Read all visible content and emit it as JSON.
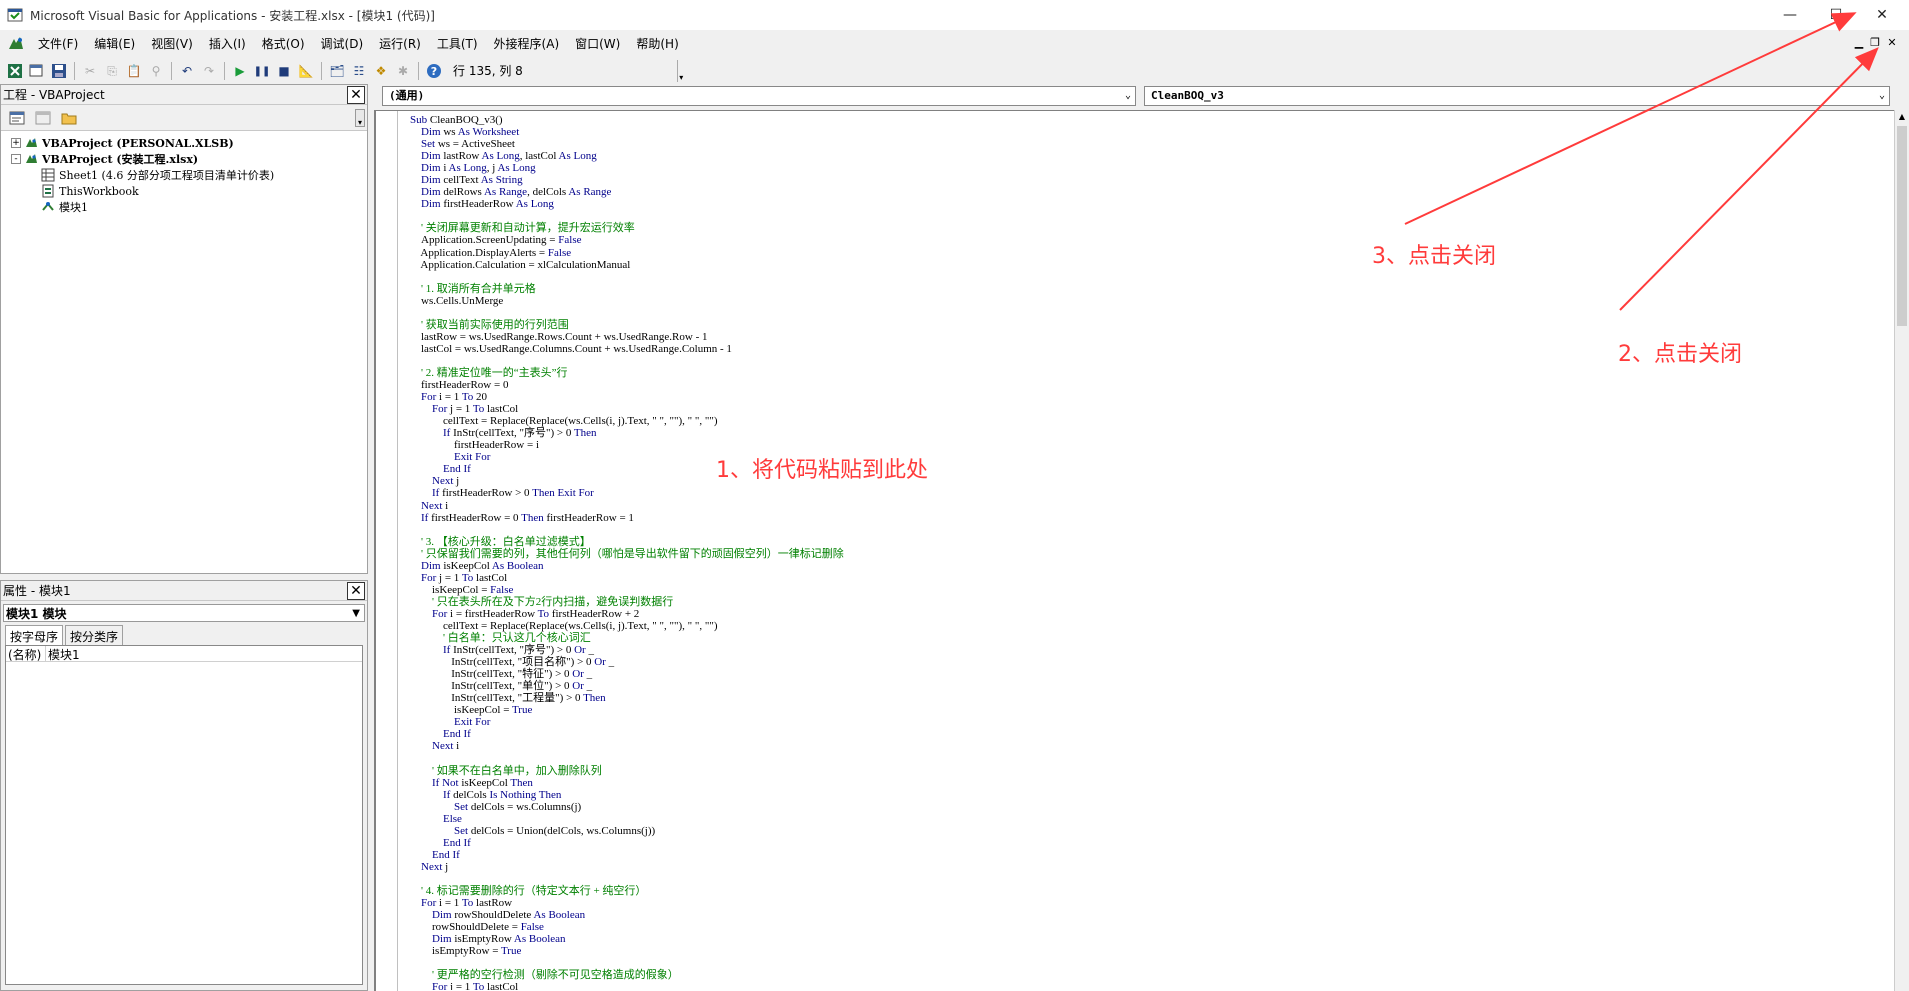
{
  "window": {
    "title": "Microsoft Visual Basic for Applications - 安装工程.xlsx - [模块1 (代码)]",
    "icons": {
      "app": "vba-app-icon",
      "minimize": "minimize-icon",
      "maximize": "maximize-icon",
      "close": "close-icon"
    }
  },
  "menu": {
    "items": [
      "文件(F)",
      "编辑(E)",
      "视图(V)",
      "插入(I)",
      "格式(O)",
      "调试(D)",
      "运行(R)",
      "工具(T)",
      "外接程序(A)",
      "窗口(W)",
      "帮助(H)"
    ]
  },
  "toolbar": {
    "position_text": "行 135, 列 8"
  },
  "project_panel": {
    "title": "工程 - VBAProject",
    "tree": [
      {
        "level": 0,
        "expander": "+",
        "label": "VBAProject (PERSONAL.XLSB)",
        "bold": true,
        "icon": "vba-project-icon"
      },
      {
        "level": 0,
        "expander": "-",
        "label": "VBAProject (安装工程.xlsx)",
        "bold": true,
        "icon": "vba-project-icon"
      },
      {
        "level": 1,
        "expander": "",
        "label": "Sheet1 (4.6 分部分项工程项目清单计价表)",
        "bold": false,
        "icon": "worksheet-icon"
      },
      {
        "level": 1,
        "expander": "",
        "label": "ThisWorkbook",
        "bold": false,
        "icon": "workbook-icon"
      },
      {
        "level": 1,
        "expander": "",
        "label": "模块1",
        "bold": false,
        "icon": "module-icon"
      }
    ]
  },
  "properties_panel": {
    "title": "属性 - 模块1",
    "object_select": "模块1 模块",
    "tabs": [
      "按字母序",
      "按分类序"
    ],
    "rows": [
      {
        "key": "(名称)",
        "value": "模块1"
      }
    ]
  },
  "code_editor": {
    "object_combo": "(通用)",
    "procedure_combo": "CleanBOQ_v3",
    "lines": [
      "Sub CleanBOQ_v3()",
      "    Dim ws As Worksheet",
      "    Set ws = ActiveSheet",
      "    Dim lastRow As Long, lastCol As Long",
      "    Dim i As Long, j As Long",
      "    Dim cellText As String",
      "    Dim delRows As Range, delCols As Range",
      "    Dim firstHeaderRow As Long",
      "",
      "    ' 关闭屏幕更新和自动计算，提升宏运行效率",
      "    Application.ScreenUpdating = False",
      "    Application.DisplayAlerts = False",
      "    Application.Calculation = xlCalculationManual",
      "",
      "    ' 1. 取消所有合并单元格",
      "    ws.Cells.UnMerge",
      "",
      "    ' 获取当前实际使用的行列范围",
      "    lastRow = ws.UsedRange.Rows.Count + ws.UsedRange.Row - 1",
      "    lastCol = ws.UsedRange.Columns.Count + ws.UsedRange.Column - 1",
      "",
      "    ' 2. 精准定位唯一的“主表头”行",
      "    firstHeaderRow = 0",
      "    For i = 1 To 20",
      "        For j = 1 To lastCol",
      "            cellText = Replace(Replace(ws.Cells(i, j).Text, \" \", \"\"), \" \", \"\")",
      "            If InStr(cellText, \"序号\") > 0 Then",
      "                firstHeaderRow = i",
      "                Exit For",
      "            End If",
      "        Next j",
      "        If firstHeaderRow > 0 Then Exit For",
      "    Next i",
      "    If firstHeaderRow = 0 Then firstHeaderRow = 1",
      "",
      "    ' 3. 【核心升级：白名单过滤模式】",
      "    ' 只保留我们需要的列，其他任何列（哪怕是导出软件留下的顽固假空列）一律标记删除",
      "    Dim isKeepCol As Boolean",
      "    For j = 1 To lastCol",
      "        isKeepCol = False",
      "        ' 只在表头所在及下方2行内扫描，避免误判数据行",
      "        For i = firstHeaderRow To firstHeaderRow + 2",
      "            cellText = Replace(Replace(ws.Cells(i, j).Text, \" \", \"\"), \" \", \"\")",
      "            ' 白名单：只认这几个核心词汇",
      "            If InStr(cellText, \"序号\") > 0 Or _",
      "               InStr(cellText, \"项目名称\") > 0 Or _",
      "               InStr(cellText, \"特征\") > 0 Or _",
      "               InStr(cellText, \"单位\") > 0 Or _",
      "               InStr(cellText, \"工程量\") > 0 Then",
      "                isKeepCol = True",
      "                Exit For",
      "            End If",
      "        Next i",
      "",
      "        ' 如果不在白名单中，加入删除队列",
      "        If Not isKeepCol Then",
      "            If delCols Is Nothing Then",
      "                Set delCols = ws.Columns(j)",
      "            Else",
      "                Set delCols = Union(delCols, ws.Columns(j))",
      "            End If",
      "        End If",
      "    Next j",
      "",
      "    ' 4. 标记需要删除的行（特定文本行 + 纯空行）",
      "    For i = 1 To lastRow",
      "        Dim rowShouldDelete As Boolean",
      "        rowShouldDelete = False",
      "        Dim isEmptyRow As Boolean",
      "        isEmptyRow = True",
      "",
      "        ' 更严格的空行检测（剔除不可见空格造成的假象）",
      "        For j = 1 To lastCol"
    ]
  },
  "annotations": {
    "step1": "1、将代码粘贴到此处",
    "step2": "2、点击关闭",
    "step3": "3、点击关闭",
    "color": "#ff3b3b"
  },
  "colors": {
    "keyword": "#00008b",
    "comment": "#008000"
  }
}
